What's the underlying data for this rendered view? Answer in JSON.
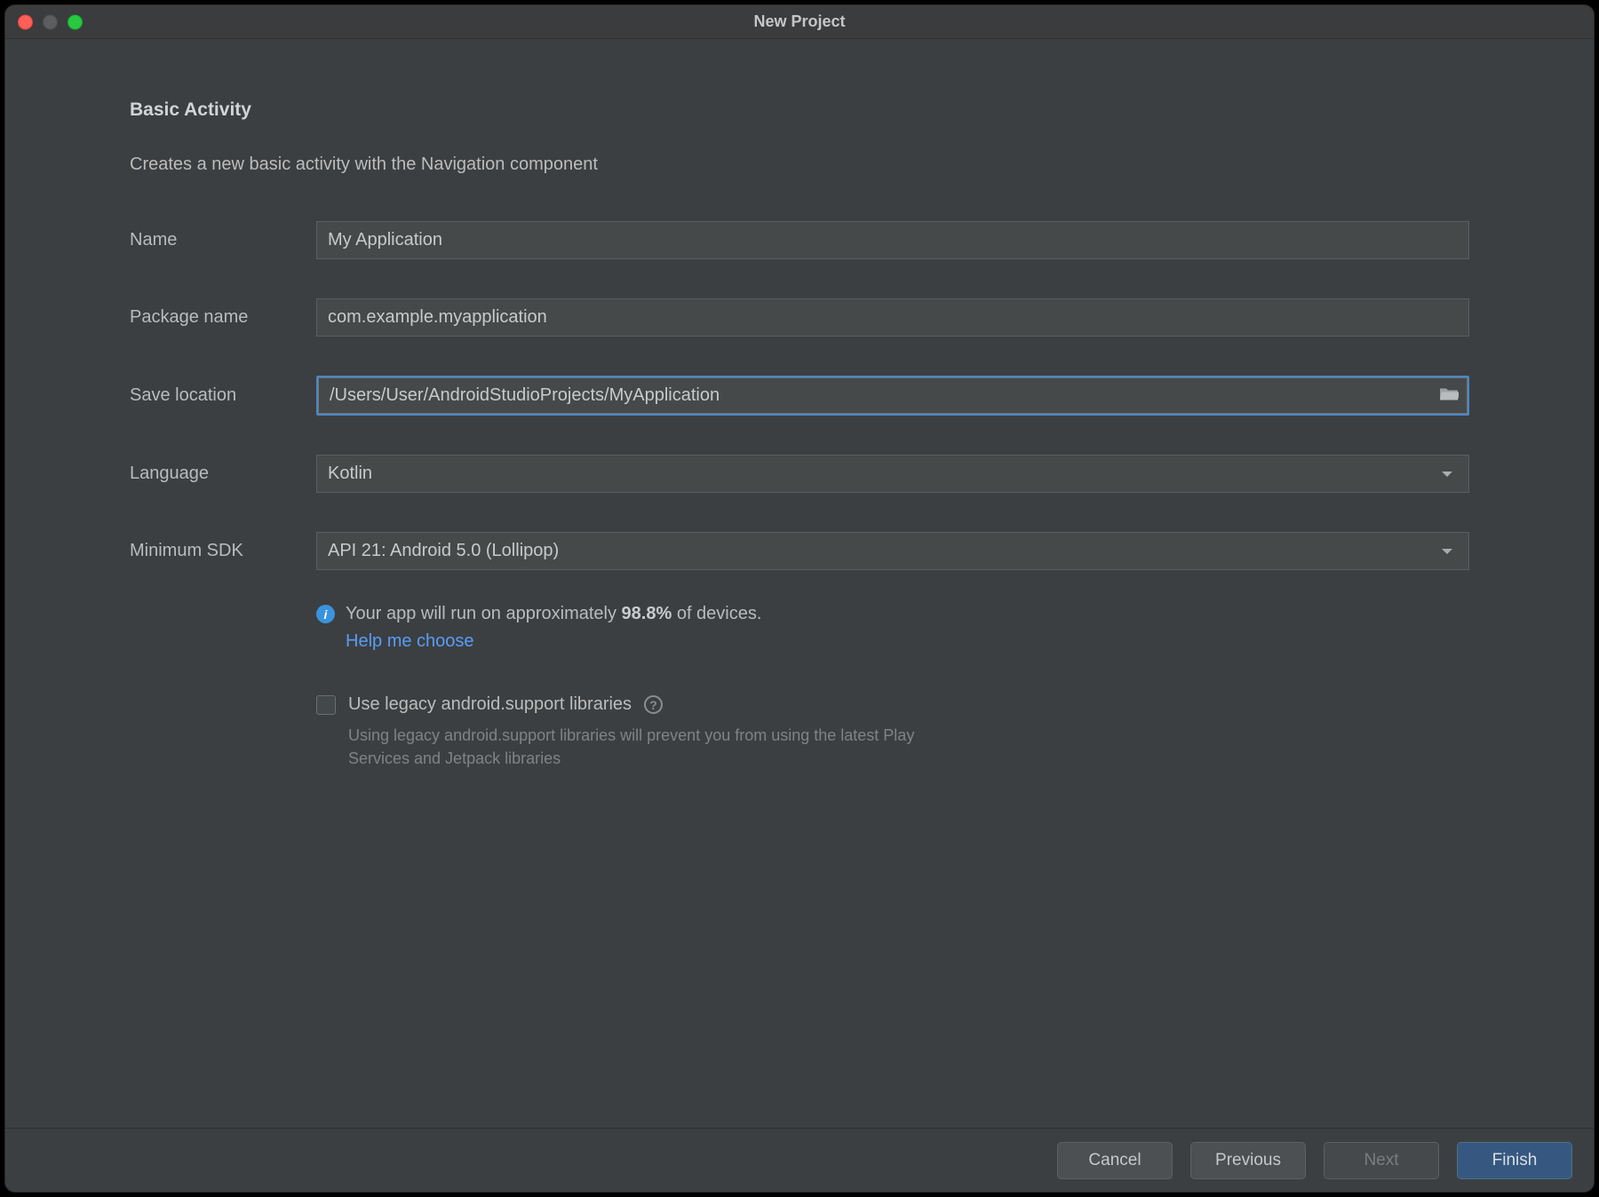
{
  "window": {
    "title": "New Project"
  },
  "page": {
    "heading": "Basic Activity",
    "description": "Creates a new basic activity with the Navigation component"
  },
  "form": {
    "name_label": "Name",
    "name_value": "My Application",
    "package_label": "Package name",
    "package_value": "com.example.myapplication",
    "location_label": "Save location",
    "location_value": "/Users/User/AndroidStudioProjects/MyApplication",
    "language_label": "Language",
    "language_value": "Kotlin",
    "minsdk_label": "Minimum SDK",
    "minsdk_value": "API 21: Android 5.0 (Lollipop)"
  },
  "info": {
    "prefix": "Your app will run on approximately ",
    "percent": "98.8%",
    "suffix": " of devices.",
    "help_link": "Help me choose"
  },
  "legacy": {
    "label": "Use legacy android.support libraries",
    "note": "Using legacy android.support libraries will prevent you from using the latest Play Services and Jetpack libraries"
  },
  "buttons": {
    "cancel": "Cancel",
    "previous": "Previous",
    "next": "Next",
    "finish": "Finish"
  }
}
